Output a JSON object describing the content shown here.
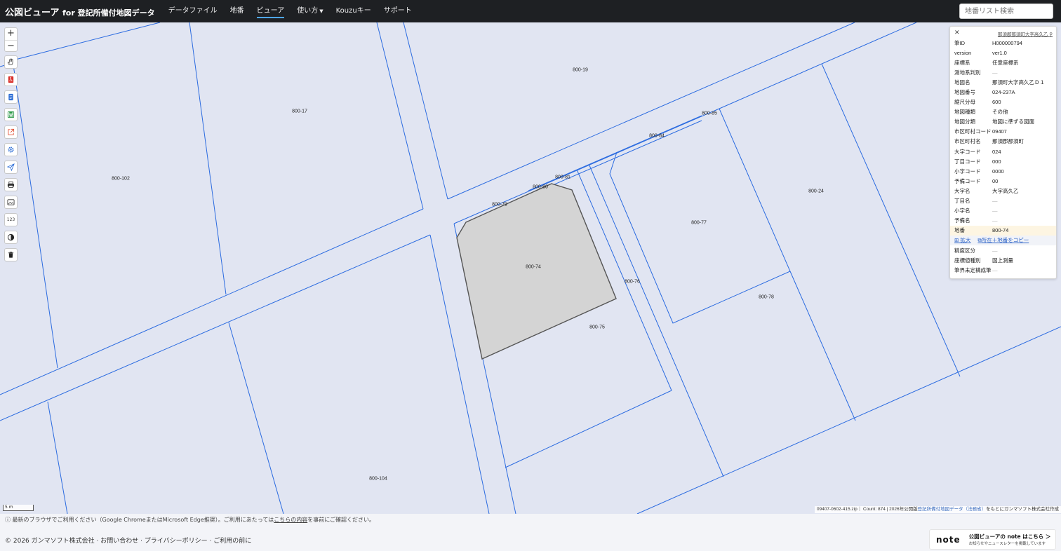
{
  "header": {
    "title": "公図ビューア",
    "title_suffix": "for 登記所備付地図データ",
    "nav": [
      {
        "label": "データファイル",
        "active": false
      },
      {
        "label": "地番",
        "active": false
      },
      {
        "label": "ビューア",
        "active": true
      },
      {
        "label": "使い方",
        "active": false,
        "dropdown": true
      },
      {
        "label": "Kouzuキー",
        "active": false
      },
      {
        "label": "サポート",
        "active": false
      }
    ],
    "search_placeholder": "地番リスト検索"
  },
  "map": {
    "parcel_labels": [
      "800-19",
      "800-17",
      "800-102",
      "800-85",
      "800-84",
      "800-81",
      "800-80",
      "800-79",
      "800-74",
      "800-77",
      "800-24",
      "800-76",
      "800-78",
      "800-75",
      "800-104",
      "800-17"
    ],
    "selected_parcel": "800-74",
    "scale_label": "5 m",
    "attribution_prefix": "09407-0602-415.zip｜ Count: 874 | 2026年公開版",
    "attribution_link": "登記所備付地図データ（法務省）",
    "attribution_suffix": "をもとにガンマソフト株式会社作成",
    "line_color": "#2b6be0",
    "background_color": "#e1e5f2",
    "selected_fill": "#d4d4d4"
  },
  "toolbar": {
    "zoom_in": "+",
    "zoom_out": "−",
    "number_tool": "123",
    "tools": [
      "hand-icon",
      "pdf-icon",
      "document-icon",
      "save-icon",
      "external-link-icon",
      "gear-icon",
      "send-icon",
      "print-icon",
      "image-icon",
      "number-icon",
      "contrast-icon",
      "trash-icon"
    ]
  },
  "panel": {
    "close": "✕",
    "location": "那須郡那須町大字高久乙",
    "rows": [
      {
        "k": "筆ID",
        "v": "H000000794"
      },
      {
        "k": "version",
        "v": "ver1.0"
      },
      {
        "k": "座標系",
        "v": "任意座標系"
      },
      {
        "k": "測地系判別",
        "v": "—"
      },
      {
        "k": "地図名",
        "v": "那須町大字高久乙Ｄ１"
      },
      {
        "k": "地図番号",
        "v": "024-237A"
      },
      {
        "k": "縮尺分母",
        "v": "600"
      },
      {
        "k": "地図種類",
        "v": "その他"
      },
      {
        "k": "地図分類",
        "v": "地図に準ずる図面"
      },
      {
        "k": "市区町村コード",
        "v": "09407"
      },
      {
        "k": "市区町村名",
        "v": "那須郡那須町"
      },
      {
        "k": "大字コード",
        "v": "024"
      },
      {
        "k": "丁目コード",
        "v": "000"
      },
      {
        "k": "小字コード",
        "v": "0000"
      },
      {
        "k": "予備コード",
        "v": "00"
      },
      {
        "k": "大字名",
        "v": "大字高久乙"
      },
      {
        "k": "丁目名",
        "v": "—"
      },
      {
        "k": "小字名",
        "v": "—"
      },
      {
        "k": "予備名",
        "v": "—"
      },
      {
        "k": "地番",
        "v": "800-74"
      }
    ],
    "action_zoom": "拡大",
    "action_copy": "所在＋地番をコピー",
    "rows_after": [
      {
        "k": "精度区分",
        "v": "—"
      },
      {
        "k": "座標値種別",
        "v": "図上測量"
      },
      {
        "k": "筆界未定構成筆",
        "v": "—"
      }
    ]
  },
  "footer": {
    "notice_prefix": "ⓘ 最新のブラウザでご利用ください（Google ChromeまたはMicrosoft Edge推奨）。ご利用にあたっては",
    "notice_link": "こちらの内容",
    "notice_suffix": "を事前にご確認ください。",
    "copyright": "© 2026 ガンマソフト株式会社 · お問い合わせ · プライバシーポリシー · ご利用の前に",
    "note_logo": "note",
    "note_line1": "公図ビューアの note はこちら ＞",
    "note_line2": "お知らせやニュースレターを掲載しています"
  }
}
